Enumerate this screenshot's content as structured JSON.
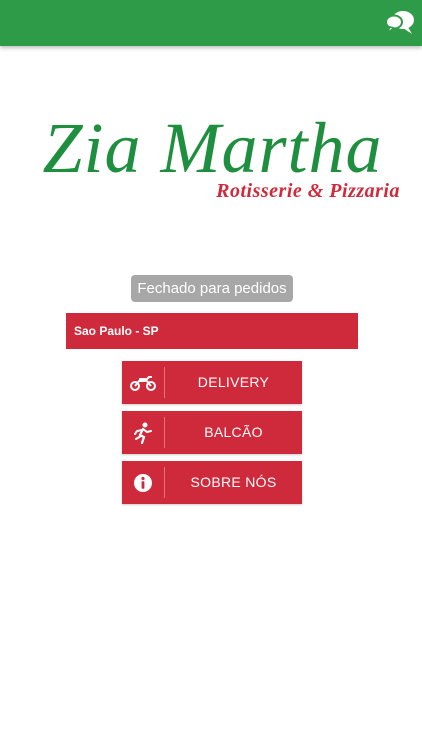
{
  "header": {
    "chat_icon": "chat-bubbles-icon",
    "color": "#2e9b48"
  },
  "logo": {
    "title": "Zia Martha",
    "subtitle": "Rotisserie & Pizzaria"
  },
  "status": {
    "text": "Fechado para pedidos"
  },
  "location": {
    "city": "Sao Paulo - SP"
  },
  "menu": [
    {
      "label": "DELIVERY",
      "icon": "motorcycle-icon"
    },
    {
      "label": "BALCÃO",
      "icon": "running-person-icon"
    },
    {
      "label": "SOBRE NÓS",
      "icon": "info-icon"
    }
  ],
  "colors": {
    "accent": "#cf2a3b",
    "brand_green": "#1e8f3e",
    "status_gray": "#a7a7a7"
  }
}
